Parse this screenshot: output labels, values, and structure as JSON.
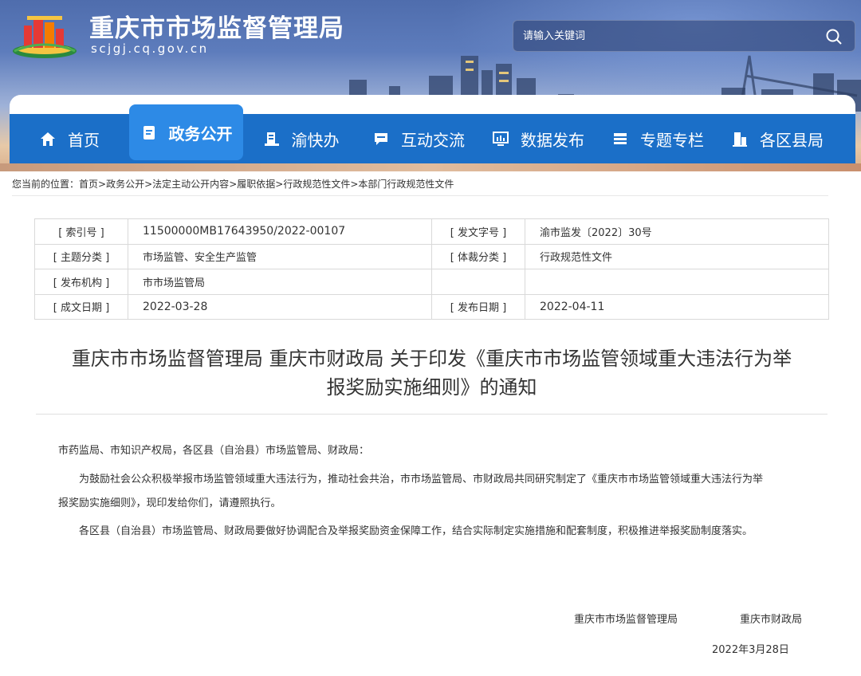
{
  "header": {
    "site_title": "重庆市市场监督管理局",
    "site_domain": "scjgj.cq.gov.cn",
    "search_placeholder": "请输入关键词"
  },
  "nav": {
    "items": [
      {
        "label": "首页",
        "icon": "home-icon"
      },
      {
        "label": "政务公开",
        "icon": "document-icon",
        "active": true
      },
      {
        "label": "渝快办",
        "icon": "office-icon"
      },
      {
        "label": "互动交流",
        "icon": "chat-icon"
      },
      {
        "label": "数据发布",
        "icon": "monitor-chart-icon"
      },
      {
        "label": "专题专栏",
        "icon": "list-icon"
      },
      {
        "label": "各区县局",
        "icon": "building-icon"
      }
    ],
    "color": "#1b6fc8",
    "active_color": "#2d8ae6"
  },
  "breadcrumb": {
    "prefix": "您当前的位置：",
    "items": [
      "首页",
      "政务公开",
      "法定主动公开内容",
      "履职依据",
      "行政规范性文件",
      "本部门行政规范性文件"
    ],
    "separator": ">"
  },
  "meta": {
    "index_no_label": "[ 索引号 ]",
    "index_no": "11500000MB17643950/2022-00107",
    "doc_no_label": "[ 发文字号 ]",
    "doc_no": "渝市监发〔2022〕30号",
    "topic_label": "[ 主题分类 ]",
    "topic": "市场监管、安全生产监管",
    "genre_label": "[ 体裁分类 ]",
    "genre": "行政规范性文件",
    "issuer_label": "[ 发布机构 ]",
    "issuer": "市市场监管局",
    "created_label": "[ 成文日期 ]",
    "created": "2022-03-28",
    "published_label": "[ 发布日期 ]",
    "published": "2022-04-11"
  },
  "article": {
    "title_line1": "重庆市市场监督管理局 重庆市财政局 关于印发《重庆市市场监管领域重大违法行为举",
    "title_line2": "报奖励实施细则》的通知",
    "salutation": "市药监局、市知识产权局，各区县（自治县）市场监管局、财政局：",
    "para1_line1": "为鼓励社会公众积极举报市场监管领域重大违法行为，推动社会共治，市市场监管局、市财政局共同研究制定了《重庆市市场监管领域重大违法行为举",
    "para1_line2": "报奖励实施细则》，现印发给你们，请遵照执行。",
    "para2": "各区县（自治县）市场监管局、财政局要做好协调配合及举报奖励资金保障工作，结合实际制定实施措施和配套制度，积极推进举报奖励制度落实。",
    "signer1": "重庆市市场监督管理局",
    "signer2": "重庆市财政局",
    "date": "2022年3月28日"
  }
}
